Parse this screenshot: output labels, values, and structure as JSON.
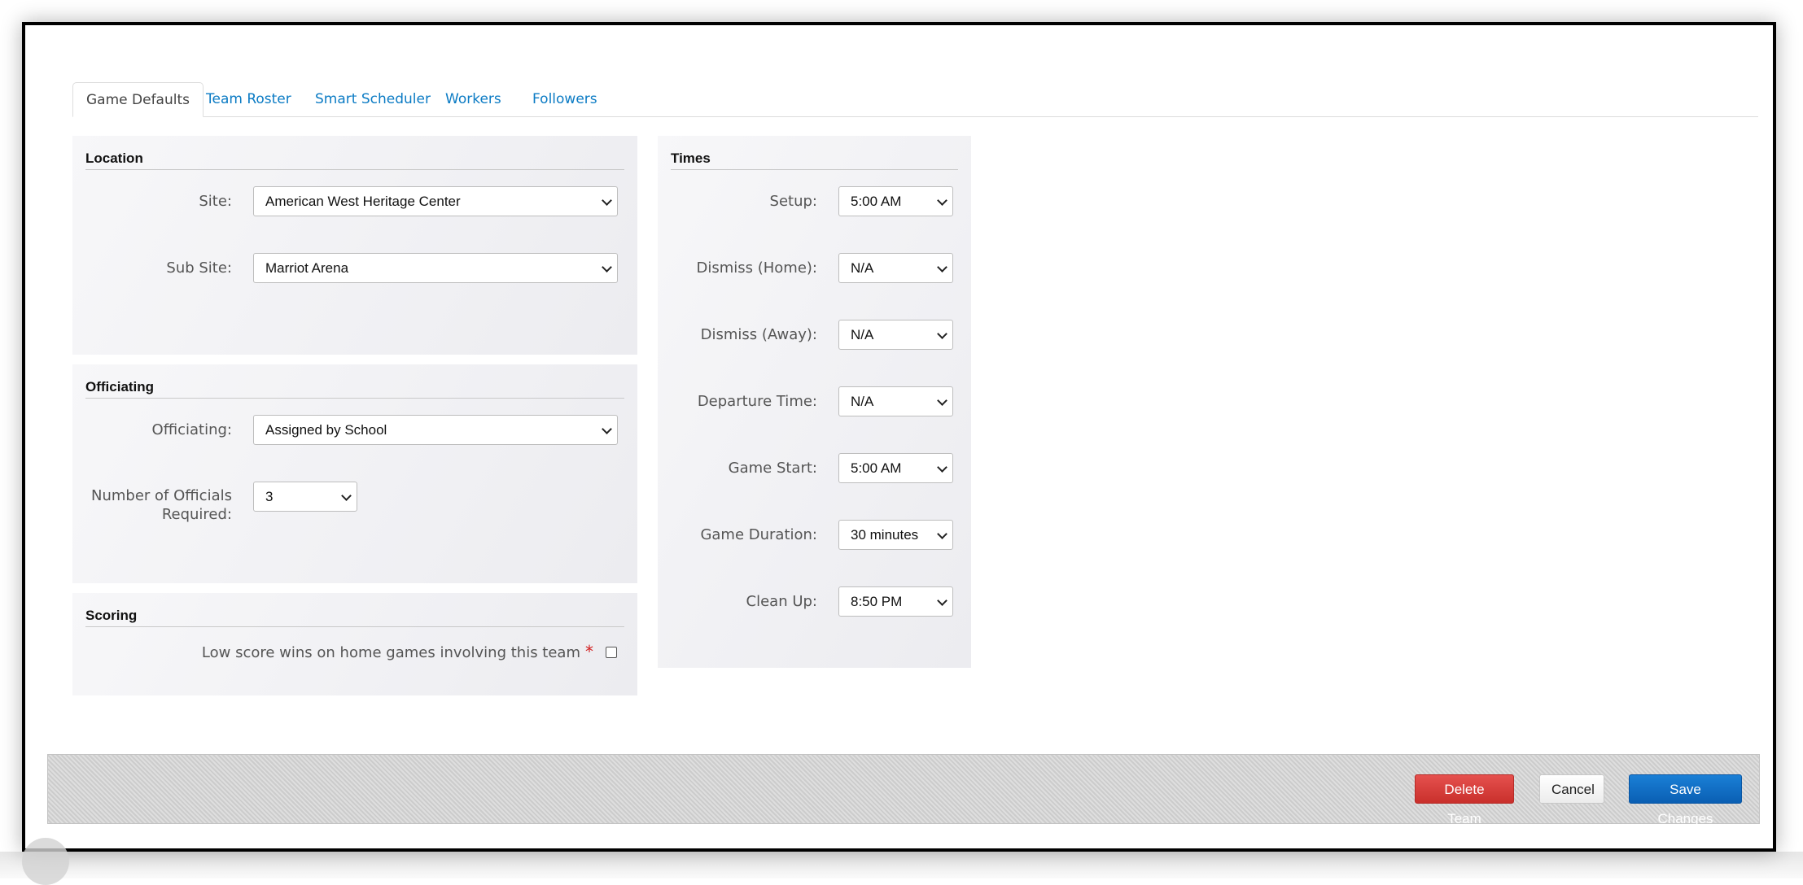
{
  "tabs": [
    {
      "label": "Game Defaults",
      "active": true
    },
    {
      "label": "Team Roster",
      "active": false
    },
    {
      "label": "Smart Scheduler",
      "active": false
    },
    {
      "label": "Workers",
      "active": false
    },
    {
      "label": "Followers",
      "active": false
    }
  ],
  "location": {
    "title": "Location",
    "site_label": "Site:",
    "site_value": "American West Heritage Center",
    "subsite_label": "Sub Site:",
    "subsite_value": "Marriot Arena"
  },
  "officiating": {
    "title": "Officiating",
    "officiating_label": "Officiating:",
    "officiating_value": "Assigned by School",
    "num_officials_label_line1": "Number of Officials",
    "num_officials_label_line2": "Required:",
    "num_officials_value": "3"
  },
  "scoring": {
    "title": "Scoring",
    "low_score_label": "Low score wins on home games involving this team",
    "required_marker": "*",
    "low_score_checked": false
  },
  "times": {
    "title": "Times",
    "setup_label": "Setup:",
    "setup_value": "5:00 AM",
    "dismiss_home_label": "Dismiss (Home):",
    "dismiss_home_value": "N/A",
    "dismiss_away_label": "Dismiss (Away):",
    "dismiss_away_value": "N/A",
    "departure_label": "Departure Time:",
    "departure_value": "N/A",
    "game_start_label": "Game Start:",
    "game_start_value": "5:00 AM",
    "game_duration_label": "Game Duration:",
    "game_duration_value": "30 minutes",
    "cleanup_label": "Clean Up:",
    "cleanup_value": "8:50 PM"
  },
  "footer": {
    "delete_label": "Delete Team",
    "cancel_label": "Cancel",
    "save_label": "Save Changes"
  },
  "colors": {
    "link": "#0b7bc4",
    "delete": "#d9403c",
    "save": "#0d66c2",
    "required": "#d21f1f"
  }
}
